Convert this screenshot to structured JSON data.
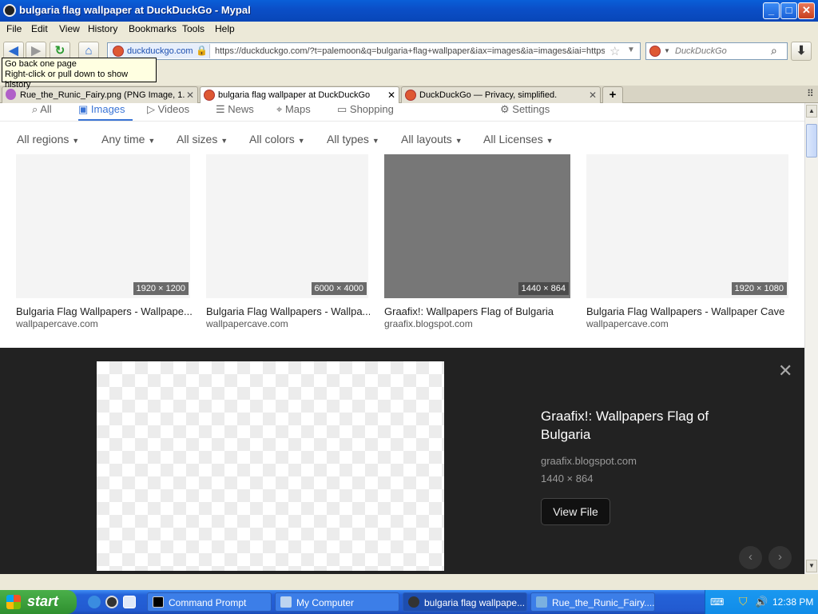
{
  "window": {
    "title": "bulgaria flag wallpaper at DuckDuckGo - Mypal",
    "controls": {
      "minimize": "_",
      "maximize": "□",
      "close": "✕"
    }
  },
  "menubar": [
    "File",
    "Edit",
    "View",
    "History",
    "Bookmarks",
    "Tools",
    "Help"
  ],
  "toolbar": {
    "identity_host": "duckduckgo.com",
    "url": "https://duckduckgo.com/?t=palemoon&q=bulgaria+flag+wallpaper&iax=images&ia=images&iai=https",
    "search_placeholder": "DuckDuckGo",
    "tooltip_line1": "Go back one page",
    "tooltip_line2": "Right-click or pull down to show history"
  },
  "tabs": [
    {
      "label": "Rue_the_Runic_Fairy.png (PNG Image, 1...",
      "active": false
    },
    {
      "label": "bulgaria flag wallpaper at DuckDuckGo",
      "active": true
    },
    {
      "label": "DuckDuckGo — Privacy, simplified.",
      "active": false
    }
  ],
  "page": {
    "nav": [
      "All",
      "Images",
      "Videos",
      "News",
      "Maps",
      "Shopping",
      "Settings"
    ],
    "active_nav": "Images",
    "filters": [
      "All regions",
      "Any time",
      "All sizes",
      "All colors",
      "All types",
      "All layouts",
      "All Licenses"
    ],
    "results": [
      {
        "dims": "1920 × 1200",
        "title": "Bulgaria Flag Wallpapers - Wallpape...",
        "source": "wallpapercave.com",
        "shade": "light"
      },
      {
        "dims": "6000 × 4000",
        "title": "Bulgaria Flag Wallpapers - Wallpa...",
        "source": "wallpapercave.com",
        "shade": "light"
      },
      {
        "dims": "1440 × 864",
        "title": "Graafix!: Wallpapers Flag of Bulgaria",
        "source": "graafix.blogspot.com",
        "shade": "dark"
      },
      {
        "dims": "1920 × 1080",
        "title": "Bulgaria Flag Wallpapers - Wallpaper Cave",
        "source": "wallpapercave.com",
        "shade": "light"
      }
    ],
    "detail": {
      "title": "Graafix!: Wallpapers Flag of Bulgaria",
      "source": "graafix.blogspot.com",
      "dims": "1440 × 864",
      "button": "View File"
    }
  },
  "taskbar": {
    "start": "start",
    "tasks": [
      {
        "label": "Command Prompt",
        "active": false
      },
      {
        "label": "My Computer",
        "active": false
      },
      {
        "label": "bulgaria flag wallpape...",
        "active": true
      },
      {
        "label": "Rue_the_Runic_Fairy....",
        "active": false
      }
    ],
    "clock": "12:38 PM"
  },
  "colors": {
    "accent": "#3a74d6",
    "titlebar": "#0b4fc8",
    "detail_bg": "#222222",
    "taskbar": "#225ad0",
    "start": "#2f8f2f"
  }
}
